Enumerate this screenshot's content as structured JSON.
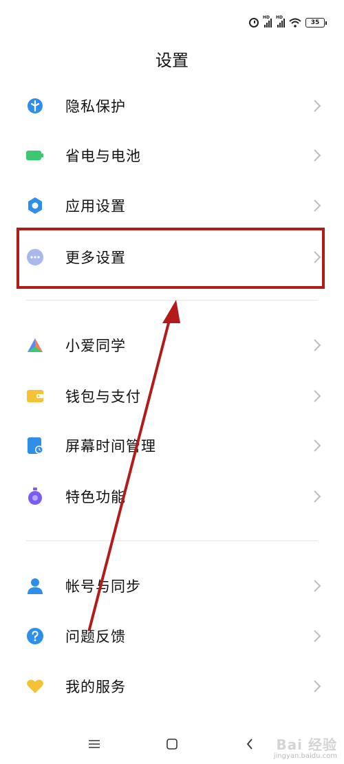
{
  "status_bar": {
    "battery": "35",
    "signal_label": "HD",
    "icons": [
      "alarm-icon",
      "signal-icon",
      "signal-icon",
      "wifi-icon",
      "battery-icon"
    ]
  },
  "page": {
    "title": "设置"
  },
  "groups": [
    {
      "items": [
        {
          "label": "隐私保护",
          "icon": "privacy-shield-icon",
          "color": "#2f8fe8"
        },
        {
          "label": "省电与电池",
          "icon": "battery-icon",
          "color": "#3cc870"
        },
        {
          "label": "应用设置",
          "icon": "gear-icon",
          "color": "#2f8fe8"
        },
        {
          "label": "更多设置",
          "icon": "more-dots-icon",
          "color": "#a9b9f0"
        }
      ]
    },
    {
      "items": [
        {
          "label": "小爱同学",
          "icon": "xiaoai-icon",
          "color": "#5a8cf5"
        },
        {
          "label": "钱包与支付",
          "icon": "wallet-icon",
          "color": "#f5c235"
        },
        {
          "label": "屏幕时间管理",
          "icon": "screen-time-icon",
          "color": "#2f8fe8"
        },
        {
          "label": "特色功能",
          "icon": "features-icon",
          "color": "#7c5cf0"
        }
      ]
    },
    {
      "items": [
        {
          "label": "帐号与同步",
          "icon": "account-icon",
          "color": "#2f8fe8"
        },
        {
          "label": "问题反馈",
          "icon": "feedback-icon",
          "color": "#2f8fe8"
        },
        {
          "label": "我的服务",
          "icon": "heart-icon",
          "color": "#f5c235"
        }
      ]
    }
  ],
  "annotation": {
    "highlighted_item": "更多设置",
    "color": "#b31b1b"
  },
  "nav": {
    "icons": [
      "menu-icon",
      "home-icon",
      "back-icon"
    ]
  },
  "watermark": {
    "brand": "Bai 经验",
    "url": "jingyan.baidu.com"
  }
}
